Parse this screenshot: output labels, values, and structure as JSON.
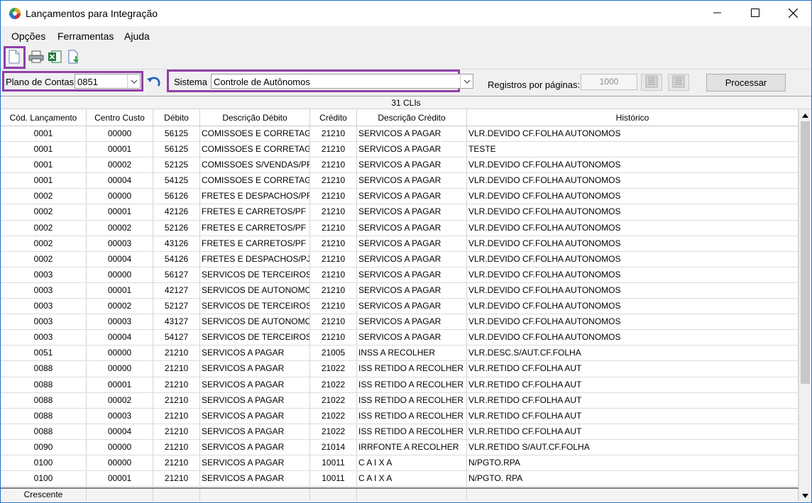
{
  "window": {
    "title": "Lançamentos para Integração"
  },
  "menu": {
    "items": [
      "Opções",
      "Ferramentas",
      "Ajuda"
    ]
  },
  "toolbar": {
    "icons": [
      "new-document-icon",
      "print-icon",
      "excel-export-icon",
      "download-icon"
    ]
  },
  "filters": {
    "plano_label": "Plano de Contas",
    "plano_value": "0851",
    "sistema_label": "Sistema",
    "sistema_value": "Controle de Autônomos",
    "registros_label": "Registros por páginas:",
    "registros_value": "1000",
    "process_label": "Processar"
  },
  "grid": {
    "count_label": "31 CLIs",
    "columns": [
      "Cód. Lançamento",
      "Centro Custo",
      "Débito",
      "Descrição Débito",
      "Crédito",
      "Descrição Crédito",
      "Histórico"
    ],
    "rows": [
      [
        "0001",
        "00000",
        "56125",
        "COMISSOES E CORRETAGEM",
        "21210",
        "SERVICOS A PAGAR",
        "VLR.DEVIDO CF.FOLHA AUTONOMOS"
      ],
      [
        "0001",
        "00001",
        "56125",
        "COMISSOES E CORRETAGEM",
        "21210",
        "SERVICOS A PAGAR",
        "TESTE"
      ],
      [
        "0001",
        "00002",
        "52125",
        "COMISSOES S/VENDAS/PF",
        "21210",
        "SERVICOS A PAGAR",
        "VLR.DEVIDO CF.FOLHA AUTONOMOS"
      ],
      [
        "0001",
        "00004",
        "54125",
        "COMISSOES E CORRETAGEM",
        "21210",
        "SERVICOS A PAGAR",
        "VLR.DEVIDO CF.FOLHA AUTONOMOS"
      ],
      [
        "0002",
        "00000",
        "56126",
        "FRETES E DESPACHOS/PF",
        "21210",
        "SERVICOS A PAGAR",
        "VLR.DEVIDO CF.FOLHA AUTONOMOS"
      ],
      [
        "0002",
        "00001",
        "42126",
        "FRETES E CARRETOS/PF",
        "21210",
        "SERVICOS A PAGAR",
        "VLR.DEVIDO CF.FOLHA AUTONOMOS"
      ],
      [
        "0002",
        "00002",
        "52126",
        "FRETES E CARRETOS/PF",
        "21210",
        "SERVICOS A PAGAR",
        "VLR.DEVIDO CF.FOLHA AUTONOMOS"
      ],
      [
        "0002",
        "00003",
        "43126",
        "FRETES E CARRETOS/PF",
        "21210",
        "SERVICOS A PAGAR",
        "VLR.DEVIDO CF.FOLHA AUTONOMOS"
      ],
      [
        "0002",
        "00004",
        "54126",
        "FRETES E DESPACHOS/PJ",
        "21210",
        "SERVICOS A PAGAR",
        "VLR.DEVIDO CF.FOLHA AUTONOMOS"
      ],
      [
        "0003",
        "00000",
        "56127",
        "SERVICOS DE TERCEIROS/",
        "21210",
        "SERVICOS A PAGAR",
        "VLR.DEVIDO CF.FOLHA AUTONOMOS"
      ],
      [
        "0003",
        "00001",
        "42127",
        "SERVICOS DE AUTONOMOS",
        "21210",
        "SERVICOS A PAGAR",
        "VLR.DEVIDO CF.FOLHA AUTONOMOS"
      ],
      [
        "0003",
        "00002",
        "52127",
        "SERVICOS DE TERCEIROS/",
        "21210",
        "SERVICOS A PAGAR",
        "VLR.DEVIDO CF.FOLHA AUTONOMOS"
      ],
      [
        "0003",
        "00003",
        "43127",
        "SERVICOS DE AUTONOMOS",
        "21210",
        "SERVICOS A PAGAR",
        "VLR.DEVIDO CF.FOLHA AUTONOMOS"
      ],
      [
        "0003",
        "00004",
        "54127",
        "SERVICOS DE TERCEIROS/",
        "21210",
        "SERVICOS A PAGAR",
        "VLR.DEVIDO CF.FOLHA AUTONOMOS"
      ],
      [
        "0051",
        "00000",
        "21210",
        "SERVICOS A PAGAR",
        "21005",
        "INSS A RECOLHER",
        "VLR.DESC.S/AUT.CF.FOLHA"
      ],
      [
        "0088",
        "00000",
        "21210",
        "SERVICOS A PAGAR",
        "21022",
        "ISS RETIDO A RECOLHER",
        "VLR.RETIDO CF.FOLHA AUT"
      ],
      [
        "0088",
        "00001",
        "21210",
        "SERVICOS A PAGAR",
        "21022",
        "ISS RETIDO A RECOLHER",
        "VLR.RETIDO CF.FOLHA AUT"
      ],
      [
        "0088",
        "00002",
        "21210",
        "SERVICOS A PAGAR",
        "21022",
        "ISS RETIDO A RECOLHER",
        "VLR.RETIDO CF.FOLHA AUT"
      ],
      [
        "0088",
        "00003",
        "21210",
        "SERVICOS A PAGAR",
        "21022",
        "ISS RETIDO A RECOLHER",
        "VLR.RETIDO CF.FOLHA AUT"
      ],
      [
        "0088",
        "00004",
        "21210",
        "SERVICOS A PAGAR",
        "21022",
        "ISS RETIDO A RECOLHER",
        "VLR.RETIDO CF.FOLHA AUT"
      ],
      [
        "0090",
        "00000",
        "21210",
        "SERVICOS A PAGAR",
        "21014",
        "IRRFONTE A RECOLHER",
        "VLR.RETIDO S/AUT.CF.FOLHA"
      ],
      [
        "0100",
        "00000",
        "21210",
        "SERVICOS A PAGAR",
        "10011",
        "C A I X A",
        "N/PGTO.RPA"
      ],
      [
        "0100",
        "00001",
        "21210",
        "SERVICOS A PAGAR",
        "10011",
        "C A I X A",
        "N/PGTO. RPA"
      ]
    ],
    "footer_label": "Crescente"
  }
}
